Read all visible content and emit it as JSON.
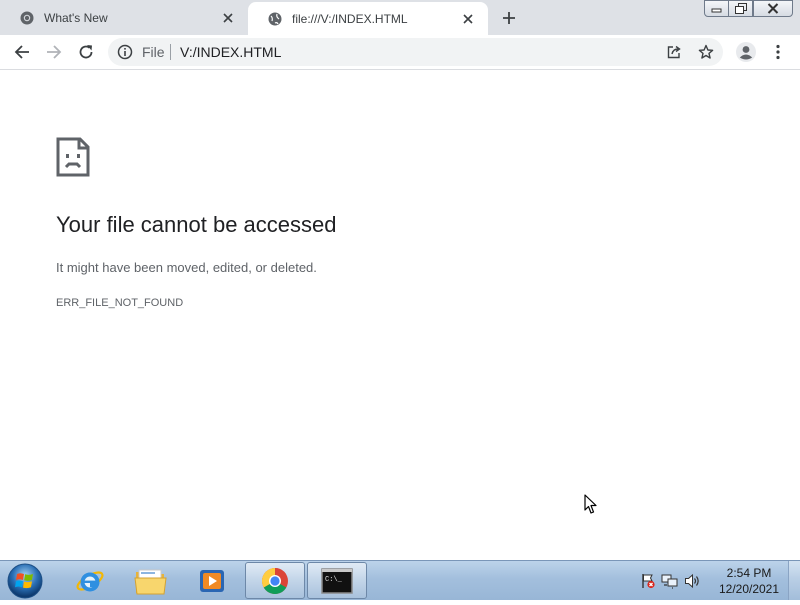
{
  "browser": {
    "tabs": [
      {
        "title": "What's New",
        "favicon": "chrome-icon",
        "active": false
      },
      {
        "title": "file:///V:/INDEX.HTML",
        "favicon": "globe-icon",
        "active": true
      }
    ],
    "omnibox": {
      "scheme_label": "File",
      "url": "V:/INDEX.HTML"
    }
  },
  "error_page": {
    "icon": "sad-file-icon",
    "title": "Your file cannot be accessed",
    "message": "It might have been moved, edited, or deleted.",
    "code": "ERR_FILE_NOT_FOUND"
  },
  "taskbar": {
    "apps": [
      "internet-explorer-icon",
      "file-explorer-icon",
      "media-player-icon",
      "chrome-icon",
      "command-prompt-icon"
    ],
    "cmd_icon_text": "C:\\_",
    "clock": {
      "time": "2:54 PM",
      "date": "12/20/2021"
    }
  },
  "colors": {
    "tabstrip": "#dee1e6",
    "omnibox": "#f1f3f4",
    "taskbar": "#a3bfdd",
    "title_text": "#202124",
    "secondary_text": "#5f6368"
  }
}
